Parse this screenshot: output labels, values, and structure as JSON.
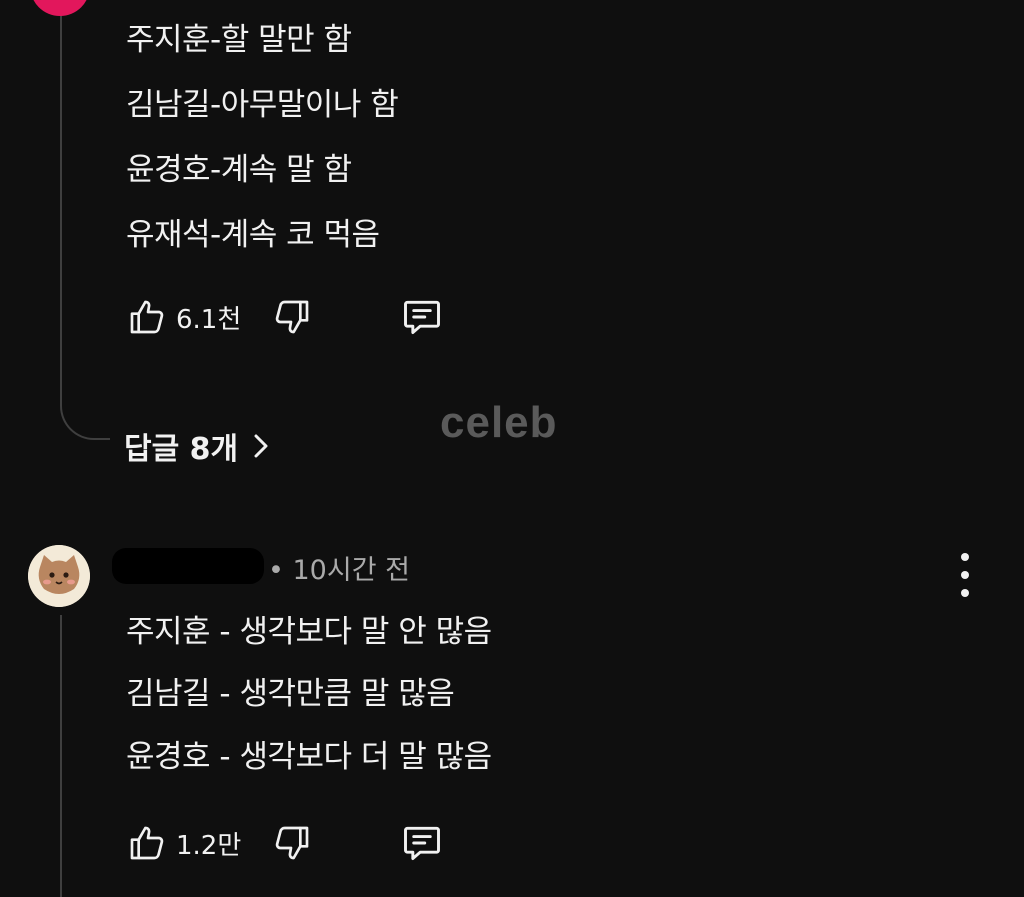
{
  "comment1": {
    "lines": [
      "주지훈-할 말만 함",
      "김남길-아무말이나 함",
      "윤경호-계속 말 함",
      "유재석-계속 코 먹음"
    ],
    "likes": "6.1천",
    "replies_label": "답글 8개",
    "avatar_color": "#e2175c"
  },
  "watermark": "celeb",
  "comment2": {
    "time": "• 10시간 전",
    "lines": [
      "주지훈 - 생각보다 말 안 많음",
      "김남길 - 생각만큼 말 많음",
      "윤경호 - 생각보다 더 말 많음"
    ],
    "likes": "1.2만"
  },
  "icons": {
    "like": "thumbs-up-icon",
    "dislike": "thumbs-down-icon",
    "reply": "comment-icon",
    "more": "more-vertical-icon",
    "chevron": "chevron-right-icon"
  }
}
